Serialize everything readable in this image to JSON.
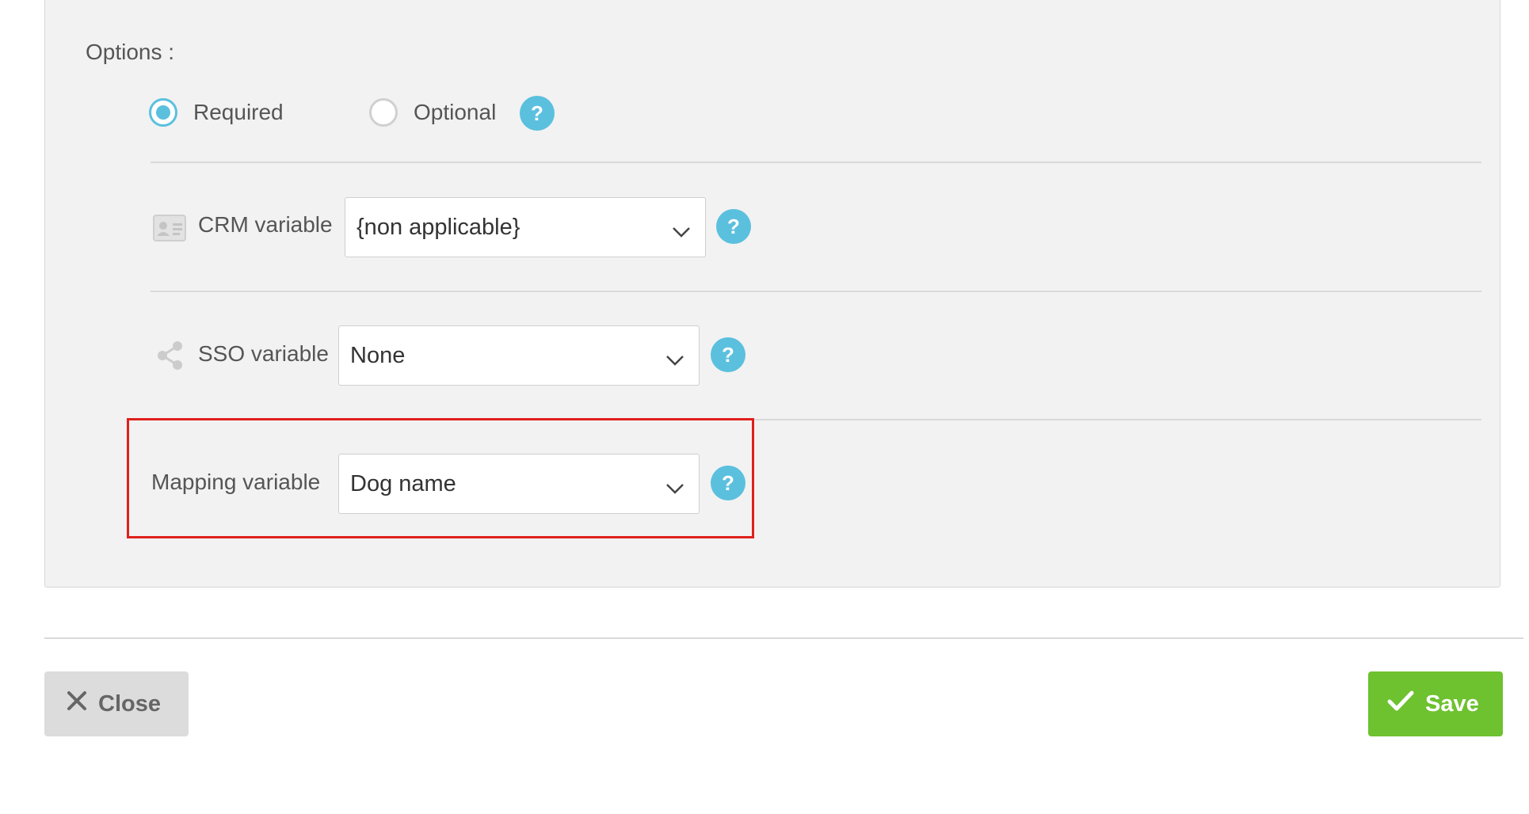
{
  "options": {
    "label": "Options :",
    "required_label": "Required",
    "optional_label": "Optional",
    "help": "?"
  },
  "crm": {
    "label": "CRM variable",
    "value": "{non applicable}",
    "help": "?"
  },
  "sso": {
    "label": "SSO variable",
    "value": "None",
    "help": "?"
  },
  "mapping": {
    "label": "Mapping variable",
    "value": "Dog name",
    "help": "?"
  },
  "footer": {
    "close_label": "Close",
    "save_label": "Save"
  },
  "colors": {
    "accent": "#5bc0de",
    "save": "#6ec12f",
    "highlight": "#e0201c"
  }
}
